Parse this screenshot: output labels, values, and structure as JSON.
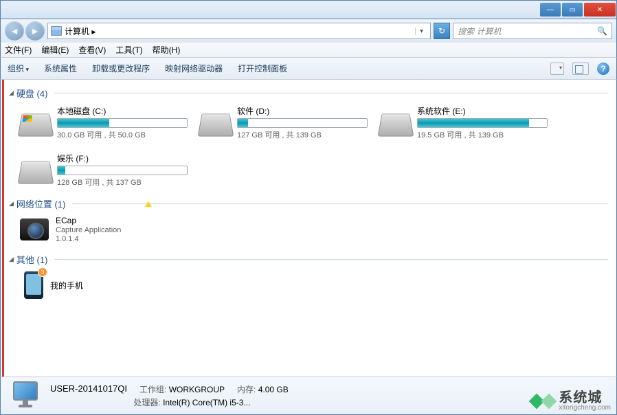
{
  "titlebar": {
    "min": "—",
    "max": "▭",
    "close": "✕"
  },
  "nav": {
    "back": "◄",
    "fwd": "►",
    "path": "计算机 ▸",
    "dropdown": "▾",
    "refresh": "↻",
    "search_placeholder": "搜索 计算机",
    "search_icon": "🔍"
  },
  "menu": {
    "file": "文件(F)",
    "edit": "编辑(E)",
    "view": "查看(V)",
    "tools": "工具(T)",
    "help": "帮助(H)"
  },
  "toolbar": {
    "organize": "组织",
    "props": "系统属性",
    "uninstall": "卸载或更改程序",
    "mapdrive": "映射网络驱动器",
    "control": "打开控制面板",
    "help": "?"
  },
  "groups": {
    "hdd": "硬盘 (4)",
    "net": "网络位置 (1)",
    "other": "其他 (1)"
  },
  "drives": [
    {
      "name": "本地磁盘 (C:)",
      "stat": "30.0 GB 可用 , 共 50.0 GB",
      "fill": 40,
      "win": true
    },
    {
      "name": "软件 (D:)",
      "stat": "127 GB 可用 , 共 139 GB",
      "fill": 8,
      "win": false
    },
    {
      "name": "系统软件 (E:)",
      "stat": "19.5 GB 可用 , 共 139 GB",
      "fill": 86,
      "win": false
    },
    {
      "name": "娱乐 (F:)",
      "stat": "128 GB 可用 , 共 137 GB",
      "fill": 6,
      "win": false
    }
  ],
  "net_item": {
    "name": "ECap",
    "desc": "Capture Application",
    "ver": "1.0.1.4"
  },
  "other_item": {
    "name": "我的手机",
    "badge": "3"
  },
  "details": {
    "name": "USER-20141017QI",
    "workgroup_label": "工作组:",
    "workgroup": "WORKGROUP",
    "mem_label": "内存:",
    "mem": "4.00 GB",
    "cpu_label": "处理器:",
    "cpu": "Intel(R) Core(TM) i5-3..."
  },
  "watermark": {
    "main": "系统城",
    "sub": "xitongcheng.com"
  }
}
